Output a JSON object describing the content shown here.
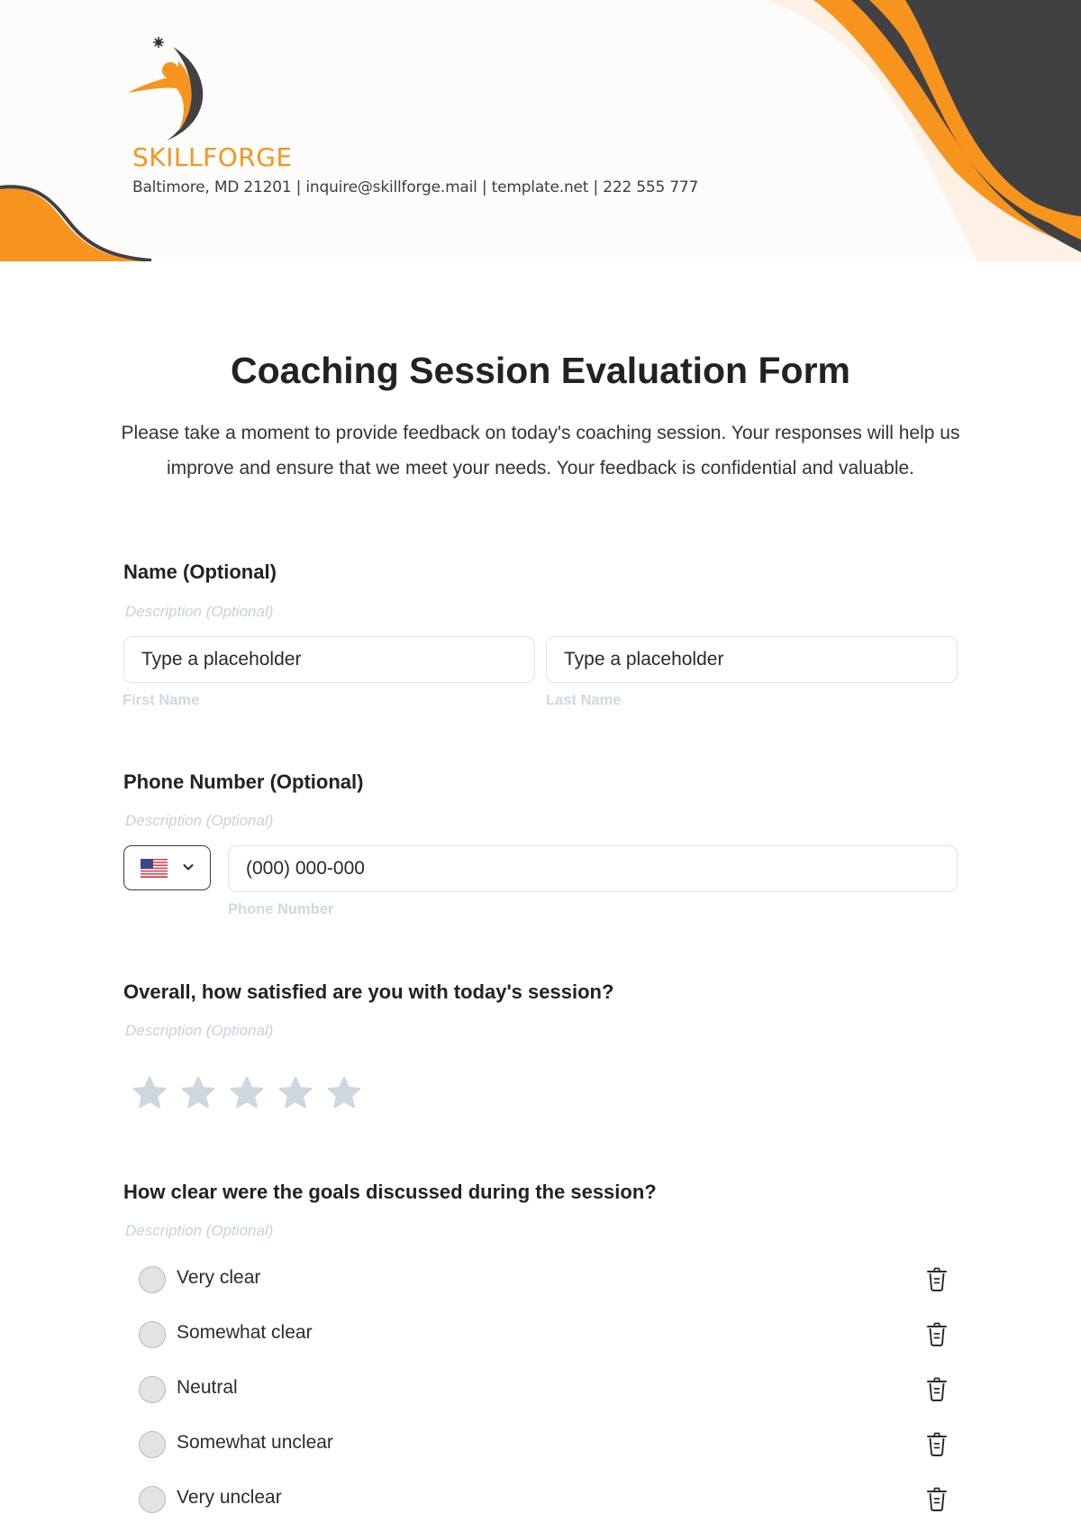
{
  "brand": {
    "name": "SKILLFORGE",
    "contact": "Baltimore, MD 21201 | inquire@skillforge.mail | template.net | 222 555 777",
    "colors": {
      "accent": "#f7941d",
      "dark": "#414042",
      "peach": "#fdf0e5"
    }
  },
  "form": {
    "title": "Coaching Session Evaluation Form",
    "intro": "Please take a moment to provide feedback on today's coaching session. Your responses will help us improve and ensure that we meet your needs. Your feedback is confidential and valuable."
  },
  "name_field": {
    "label": "Name (Optional)",
    "description": "Description (Optional)",
    "first": {
      "placeholder": "Type a placeholder",
      "sublabel": "First Name"
    },
    "last": {
      "placeholder": "Type a placeholder",
      "sublabel": "Last Name"
    }
  },
  "phone_field": {
    "label": "Phone Number (Optional)",
    "description": "Description (Optional)",
    "country_icon": "us-flag-icon",
    "placeholder": "(000) 000-000",
    "sublabel": "Phone Number"
  },
  "satisfaction": {
    "label": "Overall, how satisfied are you with today's session?",
    "description": "Description (Optional)",
    "max_rating": 5,
    "rating": 0
  },
  "goals_clarity": {
    "label": "How clear were the goals discussed during the session?",
    "description": "Description (Optional)",
    "options": [
      {
        "label": "Very clear"
      },
      {
        "label": "Somewhat clear"
      },
      {
        "label": "Neutral"
      },
      {
        "label": "Somewhat unclear"
      },
      {
        "label": "Very unclear"
      }
    ],
    "option_icon": "trash-icon"
  }
}
